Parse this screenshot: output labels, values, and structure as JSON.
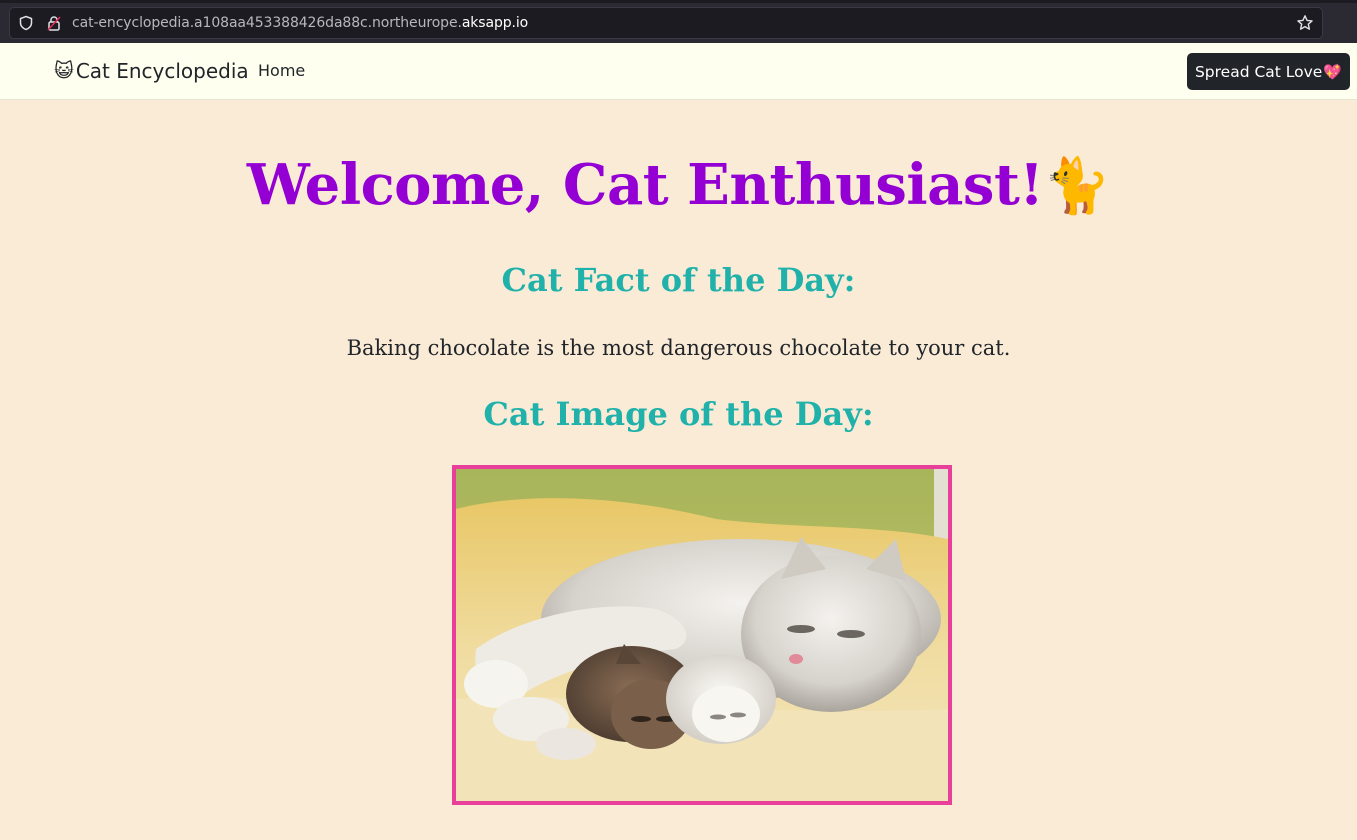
{
  "browser": {
    "url_prefix": "cat-encyclopedia.a108aa453388426da88c.northeurope.",
    "url_domain": "aksapp.io"
  },
  "navbar": {
    "brand_icon": "😺",
    "brand_label": "Cat Encyclopedia",
    "home_label": "Home",
    "spread_button_label": "Spread Cat Love",
    "spread_button_icon": "💖"
  },
  "main": {
    "welcome_title": "Welcome, Cat Enthusiast!",
    "welcome_icon": "🐈",
    "fact_heading": "Cat Fact of the Day:",
    "fact_text": "Baking chocolate is the most dangerous chocolate to your cat.",
    "image_heading": "Cat Image of the Day:",
    "image_alt_icon": "cat-photo"
  },
  "colors": {
    "page_background": "#faebd7",
    "navbar_background": "#fffff0",
    "title": "#9400d3",
    "headings": "#20b2aa",
    "image_border": "#e8409a",
    "button_background": "#212529"
  }
}
